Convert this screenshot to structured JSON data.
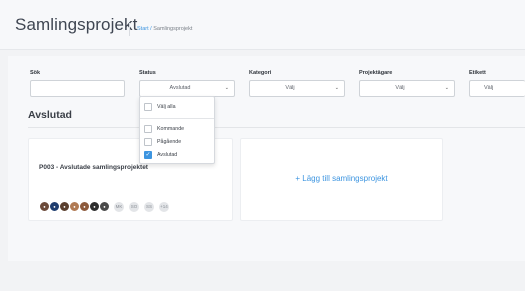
{
  "header": {
    "title": "Samlingsprojekt",
    "breadcrumb_start": "Start",
    "breadcrumb_sep": "/",
    "breadcrumb_current": "Samlingsprojekt"
  },
  "filters": {
    "search_label": "Sök",
    "search_value": "",
    "status_label": "Status",
    "status_value": "Avslutad",
    "category_label": "Kategori",
    "category_value": "Välj",
    "owner_label": "Projektägare",
    "owner_value": "Välj",
    "tag_label": "Etikett",
    "tag_value": "Välj"
  },
  "status_dropdown": {
    "select_all": "Välj alla",
    "options": [
      {
        "label": "Kommande",
        "checked": false
      },
      {
        "label": "Pågående",
        "checked": false
      },
      {
        "label": "Avslutad",
        "checked": true
      }
    ]
  },
  "section": {
    "title": "Avslutad"
  },
  "project_card": {
    "name": "P003 - Avslutade samlingsprojektet",
    "photo_avatar_colors": [
      "#6b4a3a",
      "#1f3d6e",
      "#5a3f2e",
      "#b07a53",
      "#8c5a3c",
      "#2d2d2d",
      "#4a4a4a"
    ],
    "initials": [
      "MK",
      "SO",
      "SS"
    ],
    "more_count": "+14"
  },
  "add_card": {
    "plus": "+",
    "label": "Lägg till samlingsprojekt"
  },
  "colors": {
    "accent": "#3d95e0",
    "background": "#f2f3f5"
  }
}
